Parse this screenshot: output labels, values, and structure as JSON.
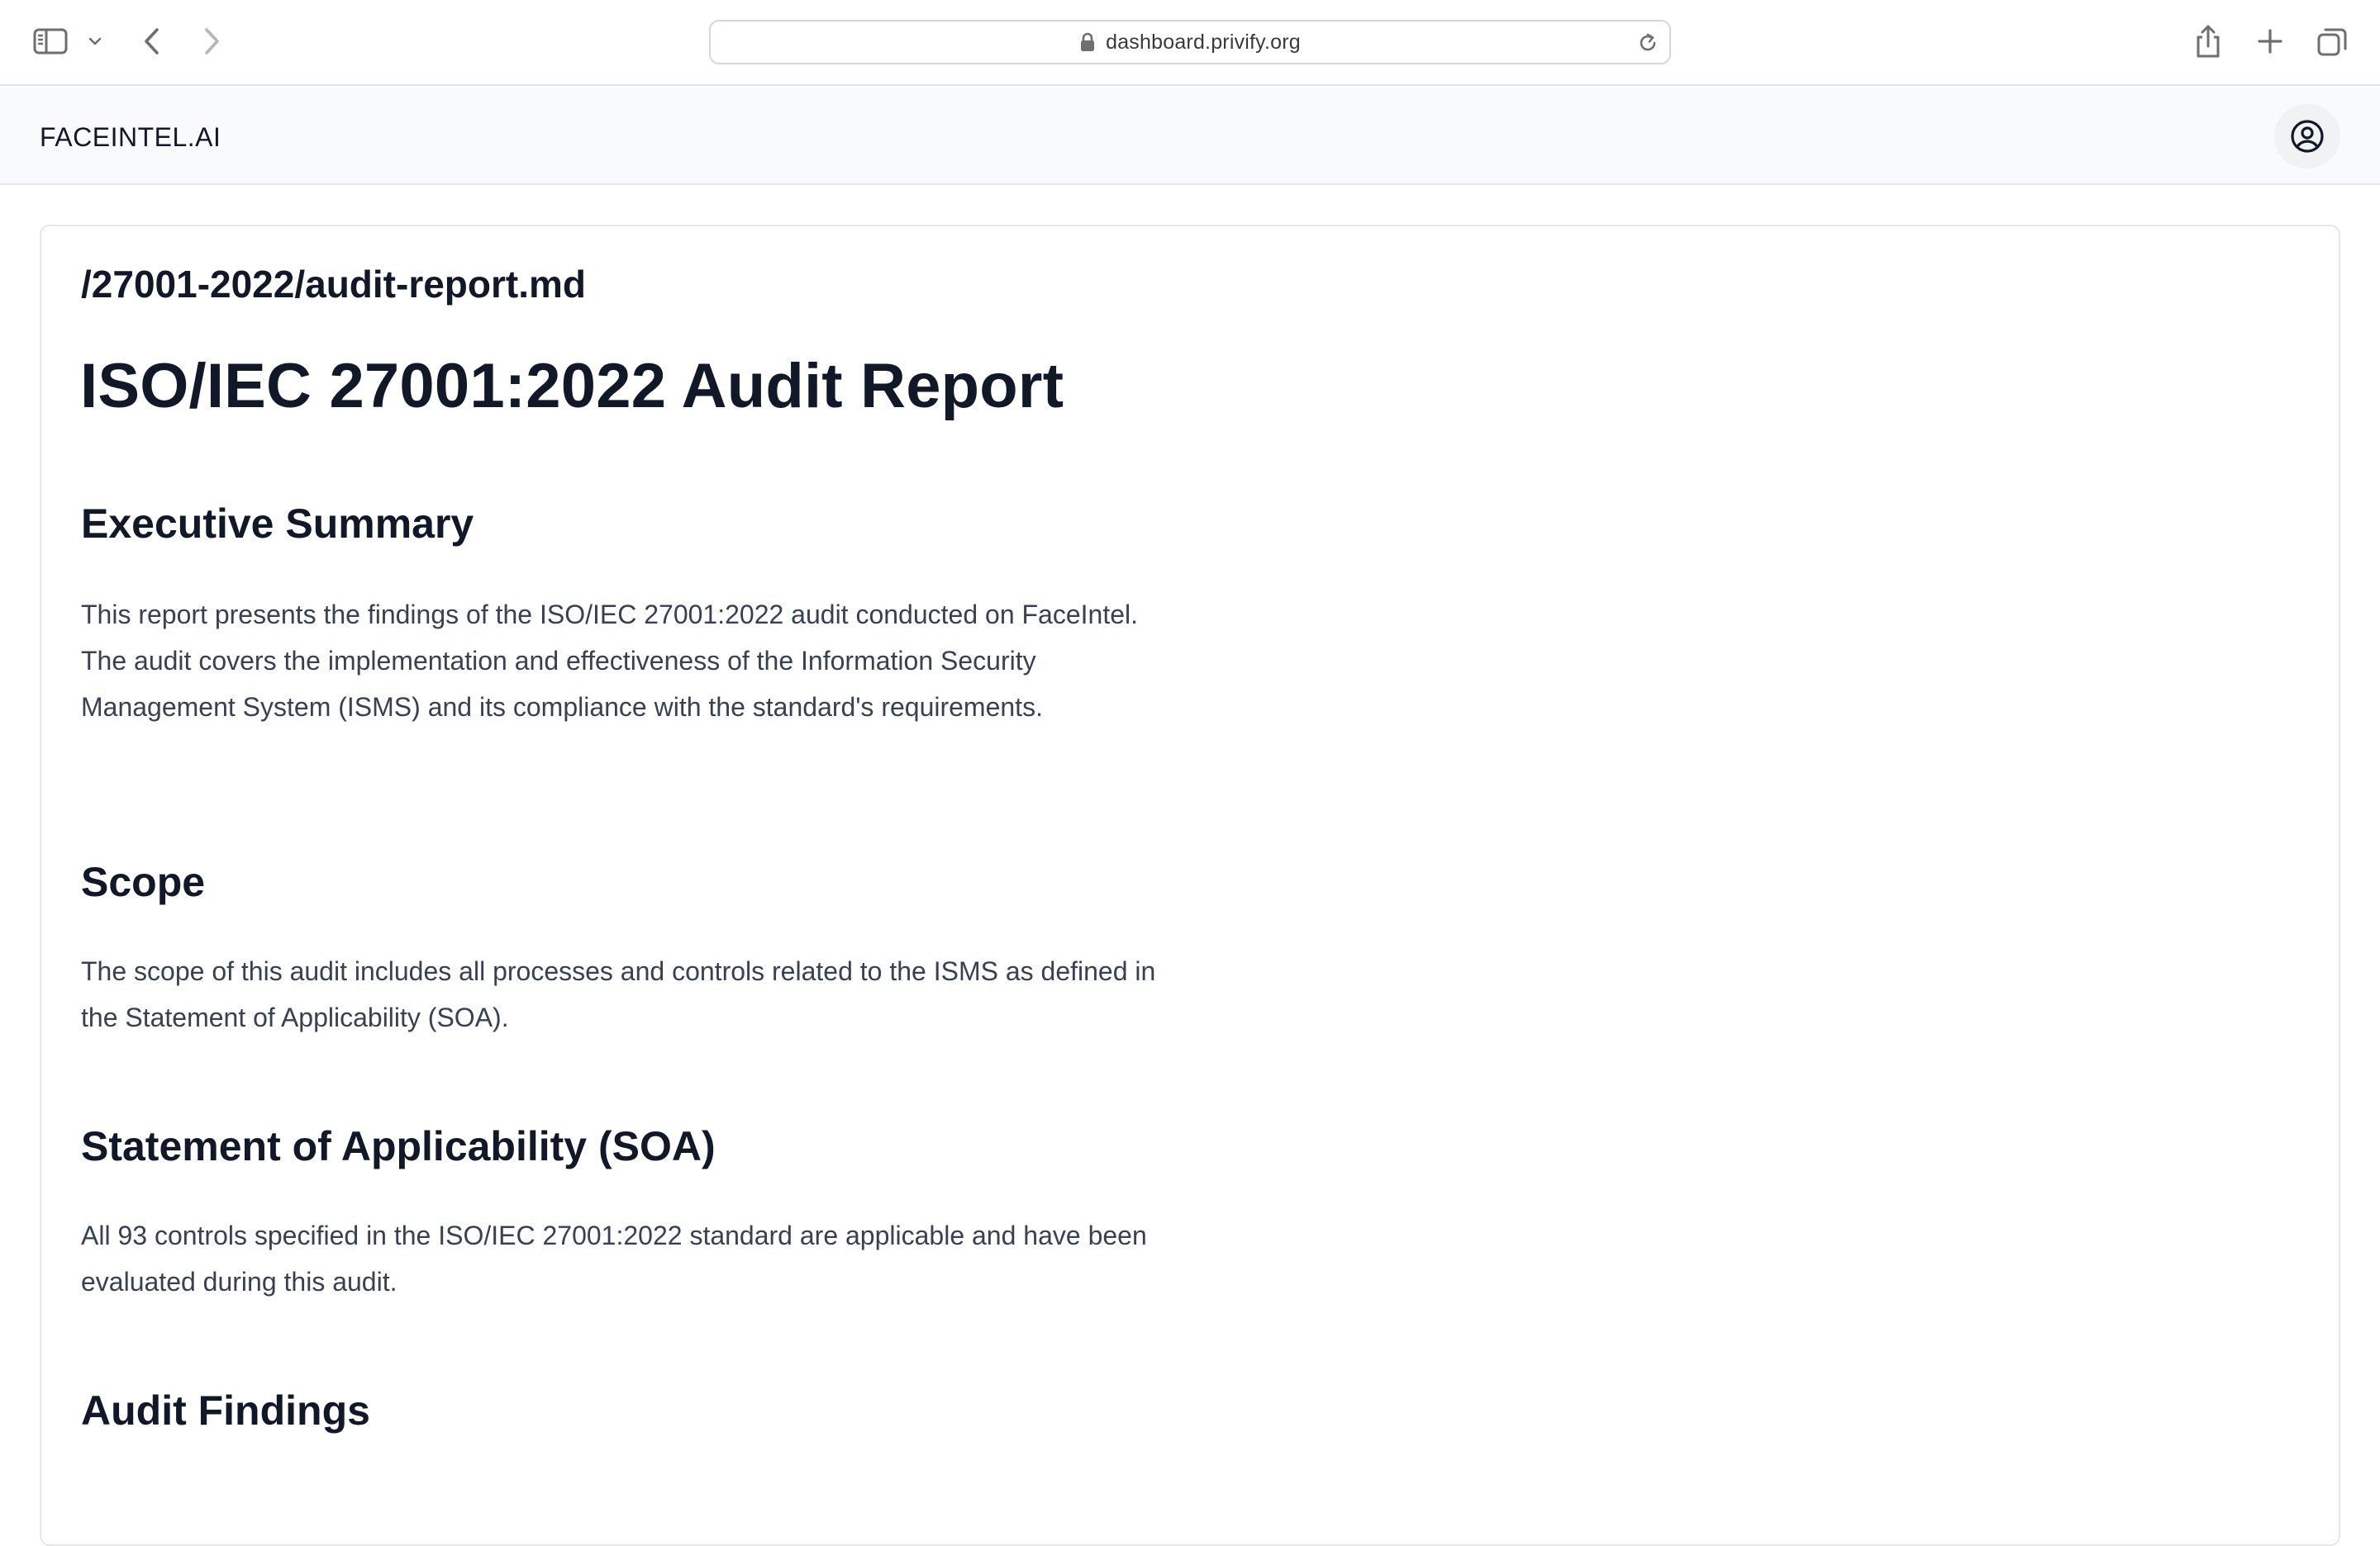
{
  "browser": {
    "url": "dashboard.privify.org",
    "icons": {
      "sidebar_toggle": "sidebar-icon",
      "sidebar_menu": "chevron-down-icon",
      "back": "chevron-left-icon",
      "forward": "chevron-right-icon",
      "lock": "lock-icon",
      "reload": "reload-icon",
      "share": "share-icon",
      "new_tab": "plus-icon",
      "tab_overview": "tabs-icon"
    }
  },
  "header": {
    "brand": "FACEINTEL.AI",
    "user_icon": "user-circle-icon"
  },
  "document": {
    "path": "/27001-2022/audit-report.md",
    "title": "ISO/IEC 27001:2022 Audit Report",
    "sections": [
      {
        "heading": "Executive Summary",
        "body": "This report presents the findings of the ISO/IEC 27001:2022 audit conducted on FaceIntel. The audit covers the implementation and effectiveness of the Information Security Management System (ISMS) and its compliance with the standard's requirements."
      },
      {
        "heading": "Scope",
        "body": "The scope of this audit includes all processes and controls related to the ISMS as defined in the Statement of Applicability (SOA)."
      },
      {
        "heading": "Statement of Applicability (SOA)",
        "body": "All 93 controls specified in the ISO/IEC 27001:2022 standard are applicable and have been evaluated during this audit."
      },
      {
        "heading": "Audit Findings",
        "body": ""
      }
    ]
  },
  "colors": {
    "text_primary": "#111827",
    "text_body": "#374151",
    "header_bg": "#f9fafb",
    "border": "#e5e7eb"
  }
}
